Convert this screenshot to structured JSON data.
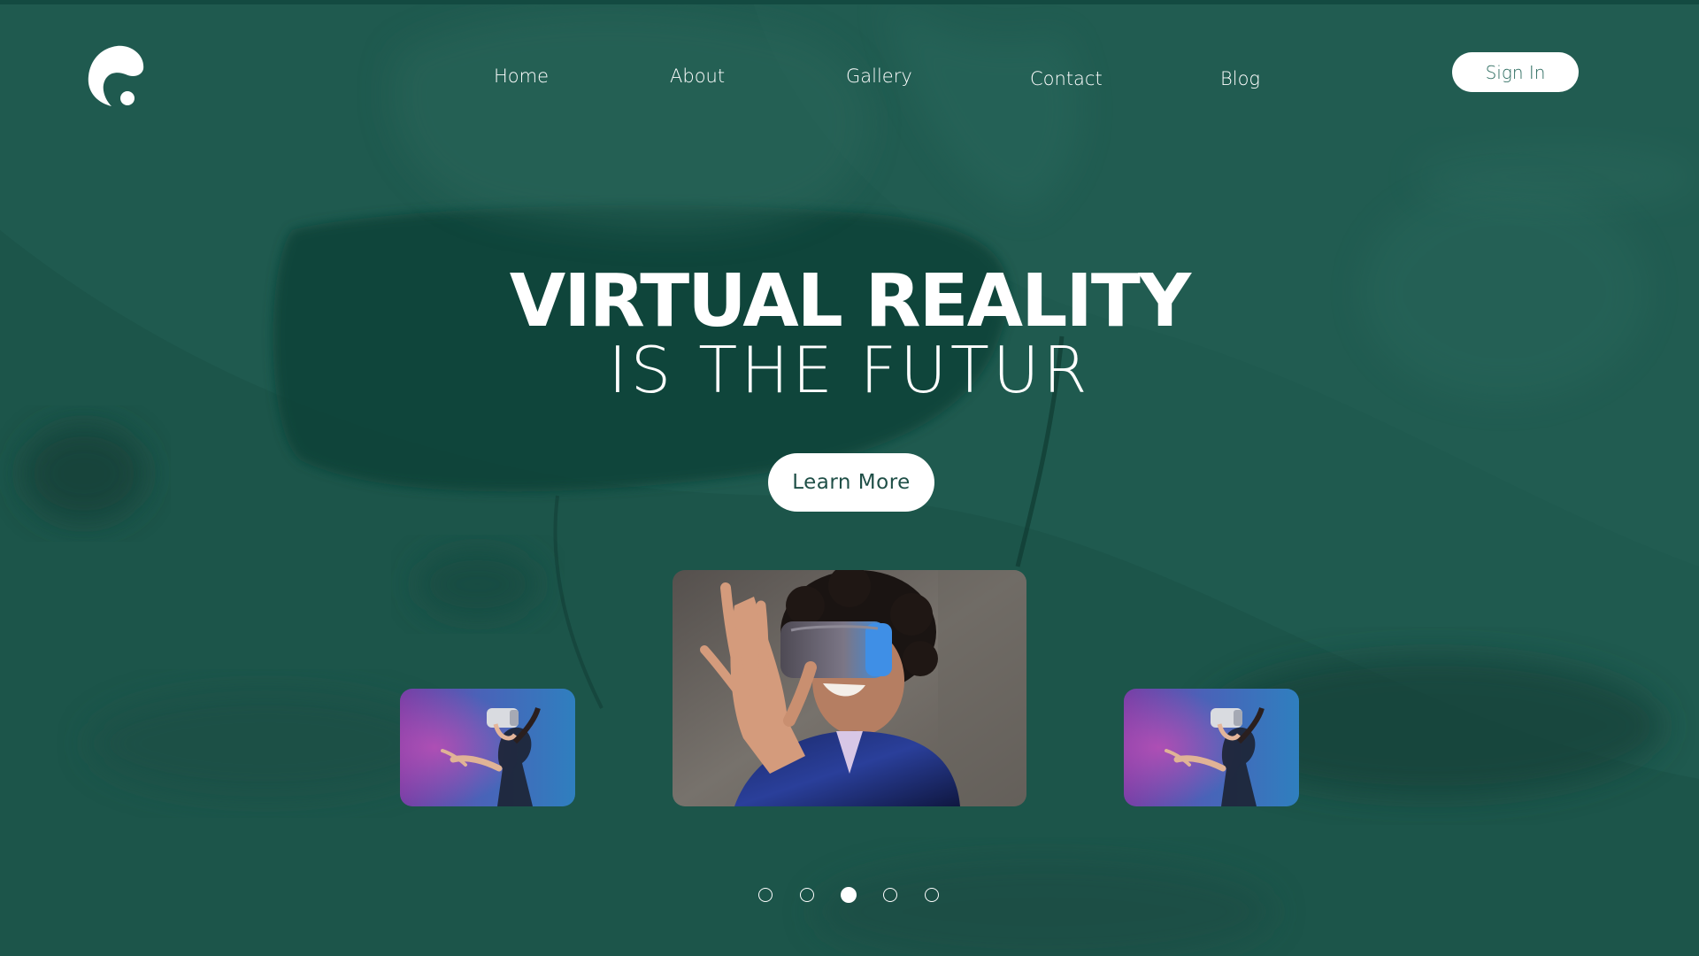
{
  "header": {
    "logo_icon": "swirl-logo-icon",
    "nav": {
      "home": "Home",
      "about": "About",
      "gallery": "Gallery",
      "contact": "Contact",
      "blog": "Blog"
    },
    "signin_label": "Sign In"
  },
  "hero": {
    "title": "VIRTUAL REALITY",
    "subtitle": "IS THE FUTUR",
    "cta_label": "Learn More"
  },
  "gallery": {
    "cards": [
      {
        "image": "woman-vr-headset-purple-photo"
      },
      {
        "image": "person-curly-hair-vr-headset-photo"
      },
      {
        "image": "woman-vr-headset-purple-photo"
      }
    ]
  },
  "carousel": {
    "dot_count": 5,
    "active_index": 2
  },
  "colors": {
    "background": "#1f5a4f",
    "accent_dark": "#134a41",
    "button_bg": "#ffffff",
    "button_text": "#1f4f47"
  }
}
